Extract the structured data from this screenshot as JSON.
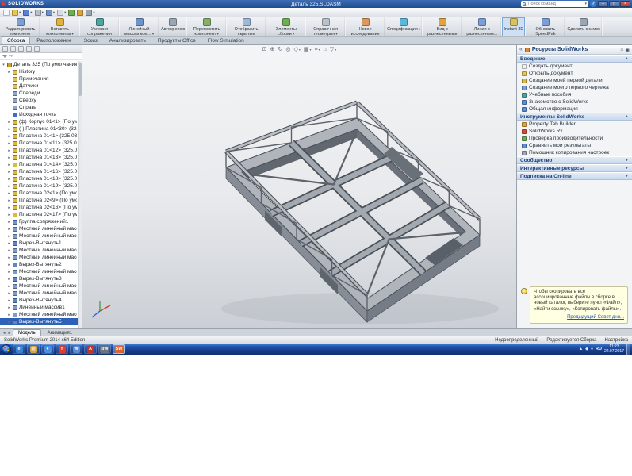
{
  "titlebar": {
    "logo": "SOLIDWORKS",
    "doc_title": "Деталь 325.SLDASM",
    "search_placeholder": "Поиск команд",
    "search_dd_glyph": "▾",
    "help_glyph": "?",
    "window_buttons": [
      {
        "name": "minimize-button",
        "glyph": "–"
      },
      {
        "name": "maximize-button",
        "glyph": "□"
      },
      {
        "name": "close-button",
        "glyph": "×"
      }
    ]
  },
  "quick_access": {
    "icons": [
      {
        "name": "new-document-icon",
        "color": "#f5f7fa"
      },
      {
        "name": "open-icon",
        "color": "#e8c557",
        "dd": 1
      },
      {
        "name": "save-icon",
        "color": "#5b7fd4",
        "dd": 1
      },
      {
        "name": "print-icon",
        "color": "#b8c0ca",
        "dd": 1
      },
      {
        "name": "undo-icon",
        "color": "#6f93c8",
        "dd": 1
      },
      {
        "name": "select-icon",
        "color": "#d8dde3",
        "dd": 1
      },
      {
        "name": "rebuild-icon",
        "color": "#6fae52"
      },
      {
        "name": "file-properties-icon",
        "color": "#d9a53b"
      },
      {
        "name": "options-icon",
        "color": "#9aa6b4",
        "dd": 1
      }
    ]
  },
  "ribbon": {
    "buttons": [
      {
        "name": "edit-component-button",
        "label": "Редактировать компонент",
        "color": "#7b9fd4"
      },
      {
        "name": "insert-components-button",
        "label": "Вставить компоненты",
        "color": "#e2b23c",
        "dd": 1
      },
      {
        "name": "mate-button",
        "label": "Условия сопряжения",
        "color": "#4fa3a0"
      },
      {
        "name": "linear-component-pattern-button",
        "label": "Линейный массив ком...",
        "color": "#6f93c8",
        "dd": 1
      },
      {
        "name": "smart-fasteners-button",
        "label": "Автокрепеж",
        "color": "#9aa6b4"
      },
      {
        "name": "move-component-button",
        "label": "Переместить компонент",
        "color": "#84b06a",
        "dd": 1
      },
      {
        "name": "show-hidden-components-button",
        "label": "Отобразить скрытые компоненты",
        "color": "#9db8d8"
      },
      {
        "name": "assembly-features-button",
        "label": "Элементы сборки",
        "color": "#6fae52",
        "dd": 1
      },
      {
        "name": "reference-geometry-button",
        "label": "Справочная геометрия",
        "color": "#b9c2cc",
        "dd": 1
      },
      {
        "name": "new-motion-study-button",
        "label": "Новое исследование движения",
        "color": "#d99a5b"
      },
      {
        "name": "bill-of-materials-button",
        "label": "Спецификация",
        "color": "#5bb8d9",
        "dd": 1
      },
      {
        "name": "exploded-view-button",
        "label": "Вид с разнесенными частями",
        "color": "#e2a23c"
      },
      {
        "name": "explode-line-sketch-button",
        "label": "Линия с разнесенным...",
        "color": "#7b9fd4"
      },
      {
        "name": "instant3d-button",
        "label": "Instant 3D",
        "color": "#d9c15b",
        "active": 1
      },
      {
        "name": "update-speedpak-button",
        "label": "Обновить SpeedPak",
        "color": "#7b9fd4"
      },
      {
        "name": "take-snapshot-button",
        "label": "Сделать снимок",
        "color": "#9aa6b4"
      }
    ]
  },
  "command_tabs": {
    "items": [
      {
        "label": "Сборка",
        "active": 1
      },
      {
        "label": "Расположение"
      },
      {
        "label": "Эскиз"
      },
      {
        "label": "Анализировать"
      },
      {
        "label": "Продукты Office"
      },
      {
        "label": "Flow Simulation"
      }
    ]
  },
  "feature_tree": {
    "tabs": [
      {
        "name": "featuremanager-tab",
        "color": "#d8b840"
      },
      {
        "name": "propertymanager-tab",
        "color": "#6fae52"
      },
      {
        "name": "configurationmanager-tab",
        "color": "#c87bd4"
      },
      {
        "name": "dimxpertmanager-tab",
        "color": "#5b8dd9"
      },
      {
        "name": "displaymanager-tab",
        "color": "#d9875b"
      }
    ],
    "items": [
      {
        "label": "Деталь 325 (По умолчанию<По",
        "lv": 0,
        "icon": "assembly",
        "exp": "▾"
      },
      {
        "label": "History",
        "lv": 1,
        "icon": "folder",
        "exp": "▸"
      },
      {
        "label": "Примечания",
        "lv": 1,
        "icon": "folder"
      },
      {
        "label": "Датчики",
        "lv": 1,
        "icon": "folder"
      },
      {
        "label": "Спереди",
        "lv": 1,
        "icon": "plane"
      },
      {
        "label": "Сверху",
        "lv": 1,
        "icon": "plane"
      },
      {
        "label": "Справа",
        "lv": 1,
        "icon": "plane"
      },
      {
        "label": "Исходная точка",
        "lv": 1,
        "icon": "origin"
      },
      {
        "label": "(ф) Корпус 01<1> (По умолч",
        "lv": 1,
        "icon": "part",
        "exp": "▸"
      },
      {
        "label": "(-) Пластина 01<30> (325.03",
        "lv": 1,
        "icon": "part",
        "exp": "▸"
      },
      {
        "label": "Пластина 01<1> (325.03.00",
        "lv": 1,
        "icon": "part",
        "exp": "▸"
      },
      {
        "label": "Пластина 01<11> (325.03.0",
        "lv": 1,
        "icon": "part",
        "exp": "▸"
      },
      {
        "label": "Пластина 01<12> (325.03.0",
        "lv": 1,
        "icon": "part",
        "exp": "▸"
      },
      {
        "label": "Пластина 01<13> (325.03.0",
        "lv": 1,
        "icon": "part",
        "exp": "▸"
      },
      {
        "label": "Пластина 01<14> (325.03.0",
        "lv": 1,
        "icon": "part",
        "exp": "▸"
      },
      {
        "label": "Пластина 01<16> (325.03.0",
        "lv": 1,
        "icon": "part",
        "exp": "▸"
      },
      {
        "label": "Пластина 01<18> (325.03.0",
        "lv": 1,
        "icon": "part",
        "exp": "▸"
      },
      {
        "label": "Пластина 01<19> (325.03.0",
        "lv": 1,
        "icon": "part",
        "exp": "▸"
      },
      {
        "label": "Пластина 02<1> (По умолч",
        "lv": 1,
        "icon": "part",
        "exp": "▸"
      },
      {
        "label": "Пластина 02<9> (По умолч",
        "lv": 1,
        "icon": "part",
        "exp": "▸"
      },
      {
        "label": "Пластина 02<16> (По умол",
        "lv": 1,
        "icon": "part",
        "exp": "▸"
      },
      {
        "label": "Пластина 02<17> (По умол",
        "lv": 1,
        "icon": "part",
        "exp": "▸"
      },
      {
        "label": "Группа сопряжений1",
        "lv": 1,
        "icon": "mates",
        "exp": "▸"
      },
      {
        "label": "Местный линейный массив",
        "lv": 1,
        "icon": "pattern",
        "exp": "▸"
      },
      {
        "label": "Местный линейный массив",
        "lv": 1,
        "icon": "pattern",
        "exp": "▸"
      },
      {
        "label": "Вырез-Вытянуть1",
        "lv": 1,
        "icon": "cut",
        "exp": "▸"
      },
      {
        "label": "Местный линейный массив",
        "lv": 1,
        "icon": "pattern",
        "exp": "▸"
      },
      {
        "label": "Местный линейный массив",
        "lv": 1,
        "icon": "pattern",
        "exp": "▸"
      },
      {
        "label": "Вырез-Вытянуть2",
        "lv": 1,
        "icon": "cut",
        "exp": "▸"
      },
      {
        "label": "Местный линейный массив",
        "lv": 1,
        "icon": "pattern",
        "exp": "▸"
      },
      {
        "label": "Вырез-Вытянуть3",
        "lv": 1,
        "icon": "cut",
        "exp": "▸"
      },
      {
        "label": "Местный линейный массив",
        "lv": 1,
        "icon": "pattern",
        "exp": "▸"
      },
      {
        "label": "Местный линейный массив",
        "lv": 1,
        "icon": "pattern",
        "exp": "▸"
      },
      {
        "label": "Вырез-Вытянуть4",
        "lv": 1,
        "icon": "cut",
        "exp": "▸"
      },
      {
        "label": "Линейный массив1",
        "lv": 1,
        "icon": "pattern",
        "exp": "▸"
      },
      {
        "label": "Местный линейный массив",
        "lv": 1,
        "icon": "pattern",
        "exp": "▸"
      },
      {
        "label": "Вырез-Вытянуть5",
        "lv": 1,
        "icon": "cut",
        "exp": "▸",
        "selected": 1
      }
    ]
  },
  "view_toolbar": {
    "icons": [
      {
        "glyph": "⊡",
        "name": "zoom-fit-icon"
      },
      {
        "glyph": "⊕",
        "name": "zoom-area-icon"
      },
      {
        "glyph": "↻",
        "name": "previous-view-icon"
      },
      {
        "glyph": "◎",
        "name": "section-view-icon"
      },
      {
        "glyph": "◇",
        "name": "view-orientation-icon",
        "dd": 1
      },
      {
        "glyph": "▦",
        "name": "display-style-icon",
        "dd": 1
      },
      {
        "glyph": "≡",
        "name": "hide-show-items-icon",
        "dd": 1
      },
      {
        "glyph": "⌂",
        "name": "edit-appearance-icon"
      },
      {
        "glyph": "▽",
        "name": "apply-scene-icon",
        "dd": 1
      }
    ]
  },
  "viewport": {
    "tab_nav": [
      {
        "glyph": "◂",
        "name": "tab-scroll-left"
      },
      {
        "glyph": "▸",
        "name": "tab-scroll-right"
      }
    ],
    "bottom_tabs": [
      {
        "label": "Модель",
        "active": 1
      },
      {
        "label": "Анимация1"
      }
    ]
  },
  "task_pane": {
    "collapse_glyph": "«",
    "title": "Ресурсы SolidWorks",
    "home_glyph": "⌂",
    "pin_glyph": "◉",
    "intro_title": "Введение",
    "intro_items": [
      {
        "label": "Создать документ",
        "color": "#f2f4f7"
      },
      {
        "label": "Открыть документ",
        "color": "#e8c557"
      },
      {
        "label": "Создание моей первой детали",
        "color": "#e0b83b"
      },
      {
        "label": "Создание моего первого чертежа",
        "color": "#7b9fd4"
      },
      {
        "label": "Учебные пособия",
        "color": "#4fa3a0"
      },
      {
        "label": "Знакомство с SolidWorks",
        "color": "#5b8dd9"
      },
      {
        "label": "Общая информация",
        "color": "#5b8dd9"
      }
    ],
    "tools_title": "Инструменты SolidWorks",
    "tools_items": [
      {
        "label": "Property Tab Builder",
        "color": "#e2a23c"
      },
      {
        "label": "SolidWorks Rx",
        "color": "#d44a3b"
      },
      {
        "label": "Проверка производительности",
        "color": "#6fae52"
      },
      {
        "label": "Сравнить мои результаты",
        "color": "#5b8dd9"
      },
      {
        "label": "Помощник копирования настроек",
        "color": "#9aa6b4"
      }
    ],
    "collapsed_sections": [
      {
        "title": "Сообщество"
      },
      {
        "title": "Интерактивные ресурсы"
      },
      {
        "title": "Подписка на On-line"
      }
    ],
    "tip": {
      "text": "Чтобы скопировать все ассоциированные файлы в сборке в новый каталог, выберите пункт «Файл», «Найти ссылку», «Копировать файлы».",
      "link": "Предыдущий Совет дня..."
    }
  },
  "status_bar": {
    "product_label": "SolidWorks Premium 2014 x64 Edition",
    "indicators": [
      "Недоопределенный",
      "Редактируется Сборка",
      "Настройка"
    ]
  },
  "taskbar": {
    "icons": [
      {
        "letter": "e",
        "color": "#3b82d4",
        "name": "internet-explorer-icon"
      },
      {
        "letter": "▤",
        "color": "#d9a53b",
        "name": "windows-explorer-icon"
      },
      {
        "letter": "●",
        "color": "#4a90e2",
        "name": "chrome-icon"
      },
      {
        "letter": "Y",
        "color": "#e23b2e",
        "name": "yandex-browser-icon"
      },
      {
        "letter": "W",
        "color": "#5b8dd4",
        "name": "word-icon"
      },
      {
        "letter": "A",
        "color": "#c03528",
        "name": "acrobat-icon"
      },
      {
        "letter": "BW",
        "color": "#6a7480",
        "name": "bw-app-icon"
      },
      {
        "letter": "SW",
        "color": "#e2622c",
        "name": "solidworks-taskbar-icon",
        "active": 1
      }
    ],
    "tray_icons": [
      {
        "glyph": "▲",
        "name": "tray-overflow-icon"
      },
      {
        "glyph": "◆",
        "name": "tray-network-icon"
      },
      {
        "glyph": "●",
        "name": "tray-volume-icon"
      }
    ],
    "lang": "RU",
    "time": "11:23",
    "date": "22.07.2017"
  }
}
